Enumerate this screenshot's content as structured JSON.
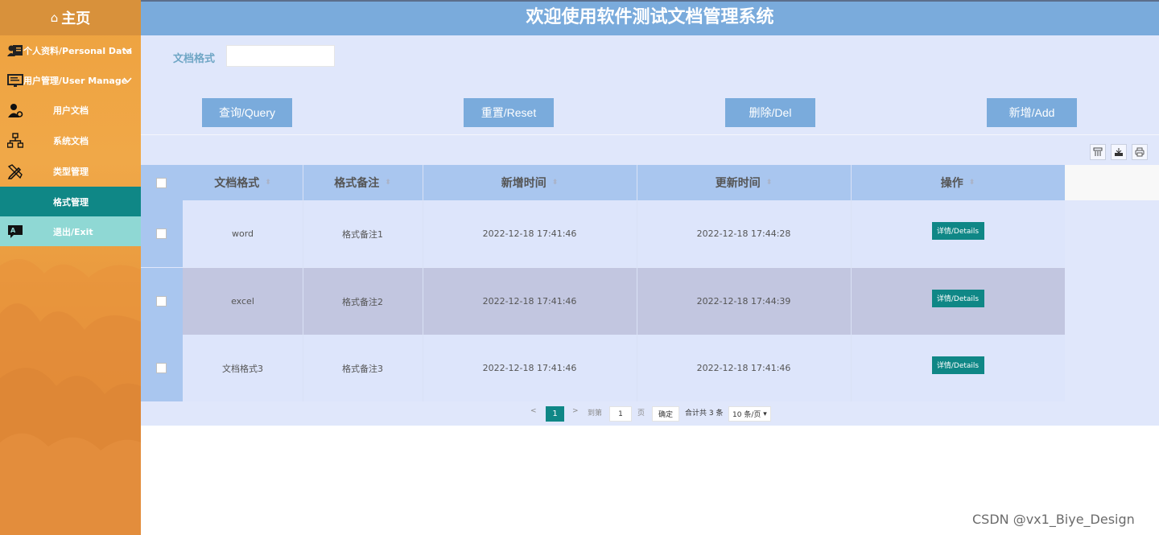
{
  "sidebar": {
    "title": "主页",
    "items": [
      {
        "label": "个人资料/Personal Data"
      },
      {
        "label": "用户管理/User Manage"
      },
      {
        "label": "用户文档"
      },
      {
        "label": "系统文档"
      },
      {
        "label": "类型管理"
      },
      {
        "label": "格式管理"
      },
      {
        "label": "退出/Exit"
      }
    ]
  },
  "header": {
    "title": "欢迎使用软件测试文档管理系统"
  },
  "search": {
    "label": "文档格式",
    "value": "",
    "placeholder": ""
  },
  "buttons": {
    "query": "查询/Query",
    "reset": "重置/Reset",
    "delete": "删除/Del",
    "add": "新增/Add"
  },
  "table": {
    "columns": [
      "文档格式",
      "格式备注",
      "新增时间",
      "更新时间",
      "操作"
    ],
    "rows": [
      {
        "format": "word",
        "note": "格式备注1",
        "created": "2022-12-18 17:41:46",
        "updated": "2022-12-18 17:44:28",
        "action": "详情/Details"
      },
      {
        "format": "excel",
        "note": "格式备注2",
        "created": "2022-12-18 17:41:46",
        "updated": "2022-12-18 17:44:39",
        "action": "详情/Details"
      },
      {
        "format": "文档格式3",
        "note": "格式备注3",
        "created": "2022-12-18 17:41:46",
        "updated": "2022-12-18 17:41:46",
        "action": "详情/Details"
      }
    ]
  },
  "pagination": {
    "current_page": "1",
    "goto_label": "到第",
    "goto_value": "1",
    "page_unit": "页",
    "confirm": "确定",
    "total": "合计共 3 条",
    "page_size": "10 条/页"
  },
  "watermark": "CSDN @vx1_Biye_Design",
  "colors": {
    "header": "#7aabdc",
    "accent": "#0f8786",
    "sidebar": "#eea23f",
    "table_head": "#a9c6ef",
    "row_alt": "#c2c6e0"
  }
}
